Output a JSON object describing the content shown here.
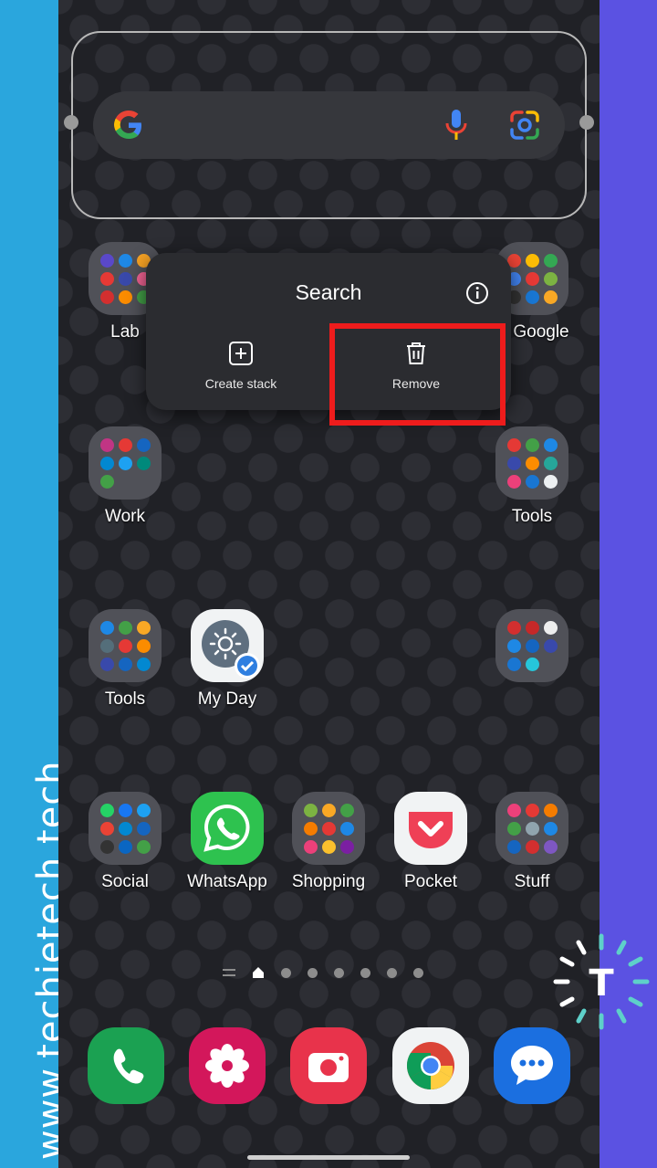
{
  "watermark": "www.techietech.tech",
  "search_widget": {
    "icons": [
      "google-g-icon",
      "microphone-icon",
      "google-lens-icon"
    ]
  },
  "popup": {
    "title": "Search",
    "create_stack_label": "Create stack",
    "remove_label": "Remove"
  },
  "apps": {
    "row1": [
      "Lab",
      "Google"
    ],
    "row2": [
      "Work",
      "Tools"
    ],
    "row3": [
      "Tools",
      "My Day"
    ],
    "row4": [
      "Social",
      "WhatsApp",
      "Shopping",
      "Pocket",
      "Stuff"
    ]
  },
  "page_indicator": {
    "pages": 7,
    "current": 1
  },
  "dock": [
    "phone-icon",
    "gallery-icon",
    "camera-icon",
    "chrome-icon",
    "messages-icon"
  ],
  "brand_logo": "T",
  "colors": {
    "highlight": "#ee1c1c",
    "left_band": "#2aa6dd",
    "right_band": "#5b52e2"
  }
}
